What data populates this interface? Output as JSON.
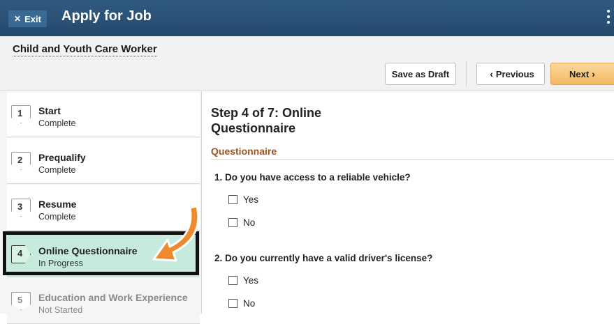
{
  "header": {
    "exit_label": "Exit",
    "title": "Apply for Job"
  },
  "job": {
    "title": "Child and Youth Care Worker"
  },
  "toolbar": {
    "save_draft_label": "Save as Draft",
    "previous_label": "Previous",
    "next_label": "Next"
  },
  "steps": [
    {
      "number": "1",
      "title": "Start",
      "status": "Complete"
    },
    {
      "number": "2",
      "title": "Prequalify",
      "status": "Complete"
    },
    {
      "number": "3",
      "title": "Resume",
      "status": "Complete"
    },
    {
      "number": "4",
      "title": "Online Questionnaire",
      "status": "In Progress"
    },
    {
      "number": "5",
      "title": "Education and Work Experience",
      "status": "Not Started"
    }
  ],
  "main": {
    "heading": "Step 4 of 7: Online Questionnaire",
    "section_title": "Questionnaire",
    "questions": [
      {
        "text": "1. Do you have access to a reliable vehicle?",
        "options": [
          "Yes",
          "No"
        ]
      },
      {
        "text": "2. Do you currently have a valid driver's license?",
        "options": [
          "Yes",
          "No"
        ]
      }
    ]
  },
  "colors": {
    "header_bg": "#2a5177",
    "active_step_bg": "#c6ebdc",
    "section_title": "#a0521b",
    "next_button": "#f3b860",
    "annotation_arrow": "#ee8a2e"
  }
}
